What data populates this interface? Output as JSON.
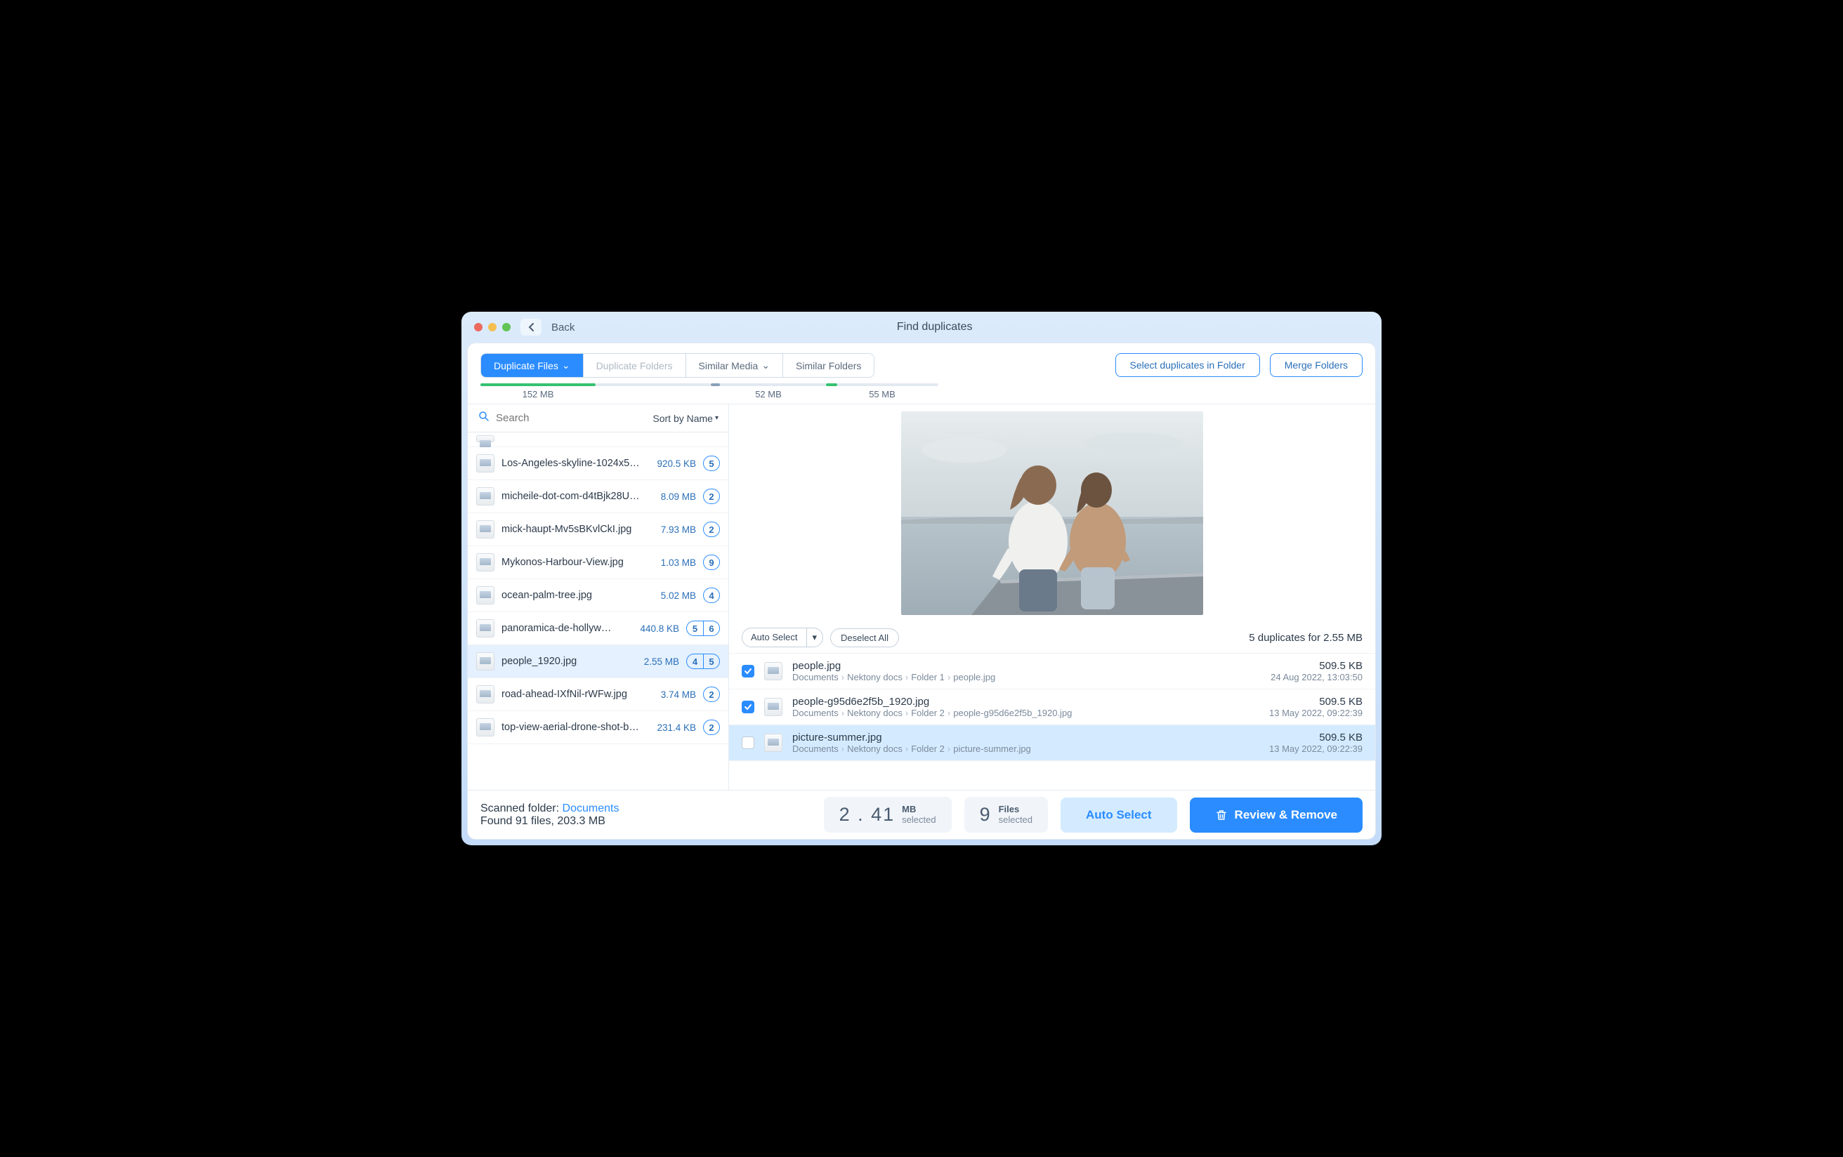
{
  "titlebar": {
    "back": "Back",
    "title": "Find duplicates"
  },
  "tabs": {
    "duplicate_files": "Duplicate Files",
    "duplicate_folders": "Duplicate Folders",
    "similar_media": "Similar Media",
    "similar_folders": "Similar Folders"
  },
  "top_actions": {
    "select_in_folder": "Select duplicates in Folder",
    "merge_folders": "Merge Folders"
  },
  "bars": {
    "b1": "152 MB",
    "b2": "52 MB",
    "b3": "55 MB"
  },
  "search": {
    "placeholder": "Search",
    "sort": "Sort by Name"
  },
  "files": [
    {
      "name": "Los-Angeles-skyline-1024x5…",
      "size": "920.5 KB",
      "badges": [
        "5"
      ]
    },
    {
      "name": "micheile-dot-com-d4tBjk28U…",
      "size": "8.09 MB",
      "badges": [
        "2"
      ]
    },
    {
      "name": "mick-haupt-Mv5sBKvlCkI.jpg",
      "size": "7.93 MB",
      "badges": [
        "2"
      ]
    },
    {
      "name": "Mykonos-Harbour-View.jpg",
      "size": "1.03 MB",
      "badges": [
        "9"
      ]
    },
    {
      "name": "ocean-palm-tree.jpg",
      "size": "5.02 MB",
      "badges": [
        "4"
      ]
    },
    {
      "name": "panoramica-de-hollyw…",
      "size": "440.8 KB",
      "badges": [
        "5",
        "6"
      ]
    },
    {
      "name": "people_1920.jpg",
      "size": "2.55 MB",
      "badges": [
        "4",
        "5"
      ],
      "selected": true
    },
    {
      "name": "road-ahead-IXfNil-rWFw.jpg",
      "size": "3.74 MB",
      "badges": [
        "2"
      ]
    },
    {
      "name": "top-view-aerial-drone-shot-b…",
      "size": "231.4 KB",
      "badges": [
        "2"
      ]
    }
  ],
  "actions": {
    "auto_select": "Auto Select",
    "deselect_all": "Deselect All"
  },
  "summary": "5 duplicates for 2.55 MB",
  "dups": [
    {
      "checked": true,
      "name": "people.jpg",
      "path": [
        "Documents",
        "Nektony docs",
        "Folder 1",
        "people.jpg"
      ],
      "size": "509.5 KB",
      "date": "24 Aug 2022, 13:03:50"
    },
    {
      "checked": true,
      "name": "people-g95d6e2f5b_1920.jpg",
      "path": [
        "Documents",
        "Nektony docs",
        "Folder 2",
        "people-g95d6e2f5b_1920.jpg"
      ],
      "size": "509.5 KB",
      "date": "13 May 2022, 09:22:39"
    },
    {
      "checked": false,
      "highlight": true,
      "name": "picture-summer.jpg",
      "path": [
        "Documents",
        "Nektony docs",
        "Folder 2",
        "picture-summer.jpg"
      ],
      "size": "509.5 KB",
      "date": "13 May 2022, 09:22:39"
    }
  ],
  "footer": {
    "scanned_prefix": "Scanned folder: ",
    "scanned_link": "Documents",
    "found": "Found 91 files, 203.3 MB",
    "mb_value": "2 . 41",
    "mb_unit": "MB",
    "mb_word": "selected",
    "files_value": "9",
    "files_unit": "Files",
    "files_word": "selected",
    "auto_select": "Auto Select",
    "review": "Review & Remove"
  }
}
